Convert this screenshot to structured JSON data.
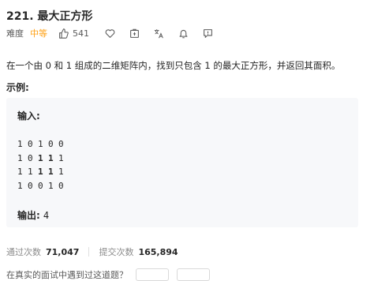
{
  "problem": {
    "title": "221. 最大正方形",
    "difficulty_label": "难度",
    "difficulty_value": "中等",
    "likes": "541"
  },
  "description": "在一个由 0 和 1 组成的二维矩阵内，找到只包含 1 的最大正方形，并返回其面积。",
  "example": {
    "title": "示例:",
    "input_label": "输入:",
    "matrix": [
      [
        "1",
        "0",
        "1",
        "0",
        "0"
      ],
      [
        "1",
        "0",
        "1",
        "1",
        "1"
      ],
      [
        "1",
        "1",
        "1",
        "1",
        "1"
      ],
      [
        "1",
        "0",
        "0",
        "1",
        "0"
      ]
    ],
    "output_label": "输出:",
    "output_value": "4"
  },
  "stats": {
    "accepted_label": "通过次数",
    "accepted_value": "71,047",
    "submissions_label": "提交次数",
    "submissions_value": "165,894"
  },
  "bottom_prompt": "在真实的面试中遇到过这道题？",
  "icons": [
    "like-icon",
    "star-icon",
    "share-icon",
    "translate-icon",
    "bell-icon",
    "feedback-icon"
  ],
  "colors": {
    "difficulty_medium": "#ffa116",
    "example_bg": "#f7f8fa"
  }
}
